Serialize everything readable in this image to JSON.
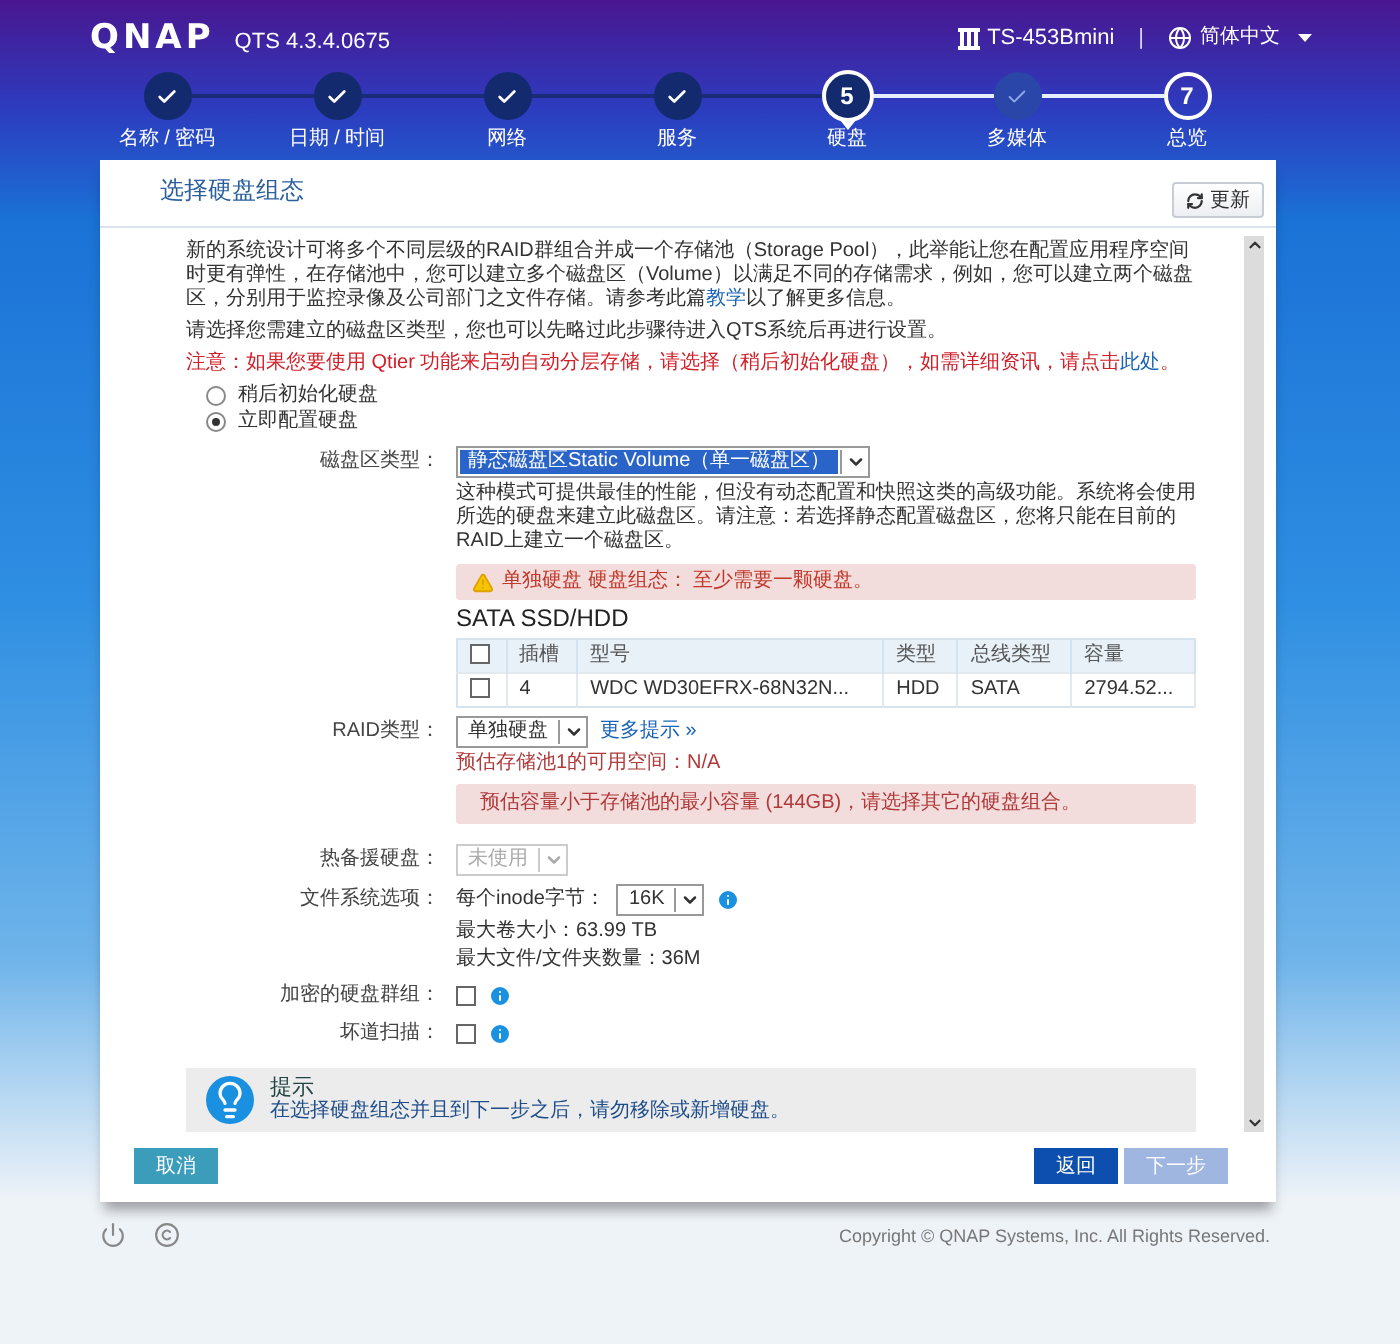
{
  "header": {
    "logo": "QNAP",
    "version": "QTS 4.3.4.0675",
    "device": "TS-453Bmini",
    "separator": "|",
    "language": "简体中文"
  },
  "steps": [
    {
      "label": "名称 / 密码",
      "kind": "done"
    },
    {
      "label": "日期 / 时间",
      "kind": "done"
    },
    {
      "label": "网络",
      "kind": "done"
    },
    {
      "label": "服务",
      "kind": "done"
    },
    {
      "label": "硬盘",
      "kind": "current",
      "number": "5"
    },
    {
      "label": "多媒体",
      "kind": "visited"
    },
    {
      "label": "总览",
      "kind": "upcoming",
      "number": "7"
    }
  ],
  "dialog": {
    "title": "选择硬盘组态",
    "refresh_button": "更新"
  },
  "intro": {
    "text_before": "新的系统设计可将多个不同层级的RAID群组合并成一个存储池（Storage Pool），此举能让您在配置应用程序空间时更有弹性，在存储池中，您可以建立多个磁盘区（Volume）以满足不同的存储需求，例如，您可以建立两个磁盘区，分别用于监控录像及公司部门之文件存储。请参考此篇",
    "link": "教学",
    "text_after": "以了解更多信息。"
  },
  "instruction": "请选择您需建立的磁盘区类型，您也可以先略过此步骤待进入QTS系统后再进行设置。",
  "notice": {
    "text_before": "注意：如果您要使用 Qtier 功能来启动自动分层存储，请选择（稍后初始化硬盘），如需详细资讯，请点击",
    "link": "此处",
    "text_after": "。"
  },
  "init_options": [
    {
      "label": "稍后初始化硬盘",
      "selected": false
    },
    {
      "label": "立即配置硬盘",
      "selected": true
    }
  ],
  "volume_type": {
    "label": "磁盘区类型：",
    "value": "静态磁盘区Static Volume（单一磁盘区）",
    "description": "这种模式可提供最佳的性能，但没有动态配置和快照这类的高级功能。系统将会使用所选的硬盘来建立此磁盘区。请注意：若选择静态配置磁盘区，您将只能在目前的RAID上建立一个磁盘区。",
    "warning": "单独硬盘 硬盘组态： 至少需要一颗硬盘。"
  },
  "disk_table": {
    "title": "SATA SSD/HDD",
    "select_all_checked": false,
    "columns": [
      "插槽",
      "型号",
      "类型",
      "总线类型",
      "容量"
    ],
    "rows": [
      {
        "checked": false,
        "cells": [
          "4",
          "WDC WD30EFRX-68N32N...",
          "HDD",
          "SATA",
          "2794.52..."
        ]
      }
    ]
  },
  "raid_type": {
    "label": "RAID类型：",
    "value": "单独硬盘",
    "more_link": "更多提示 »",
    "estimate": "预估存储池1的可用空间：N/A",
    "error": "预估容量小于存储池的最小容量 (144GB)，请选择其它的硬盘组合。"
  },
  "hot_spare": {
    "label": "热备援硬盘：",
    "value": "未使用",
    "disabled": true
  },
  "filesystem": {
    "label": "文件系统选项：",
    "inode_label": "每个inode字节：",
    "inode_value": "16K",
    "max_volume": "最大卷大小：63.99 TB",
    "max_files": "最大文件/文件夹数量：36M"
  },
  "options": [
    {
      "label": "加密的硬盘群组：",
      "checked": false
    },
    {
      "label": "坏道扫描：",
      "checked": false
    }
  ],
  "tip": {
    "title": "提示",
    "text": "在选择硬盘组态并且到下一步之后，请勿移除或新增硬盘。"
  },
  "buttons": [
    {
      "label": "取消",
      "kind": "cancel",
      "disabled": false
    },
    {
      "label": "返回",
      "kind": "back",
      "disabled": false
    },
    {
      "label": "下一步",
      "kind": "next",
      "disabled": true
    }
  ],
  "footer": {
    "copyright": "Copyright © QNAP Systems, Inc. All Rights Reserved."
  }
}
